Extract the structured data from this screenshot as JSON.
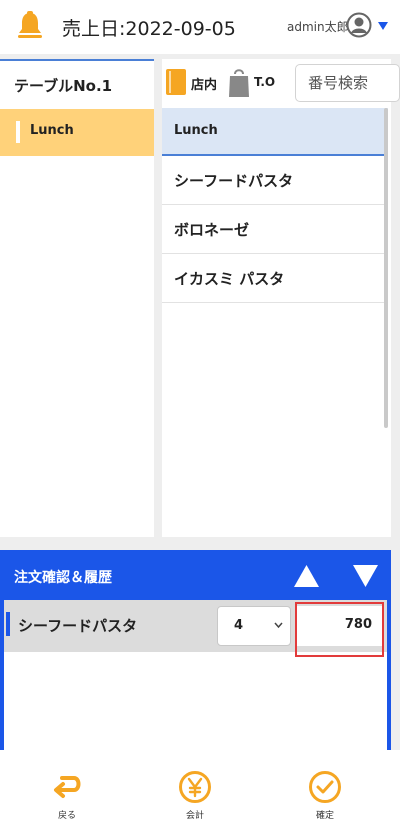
{
  "header": {
    "sales_date": "売上日:2022-09-05",
    "user_name": "admin太郎",
    "icons": [
      "bell-icon",
      "avatar-icon",
      "chevron-down-icon"
    ]
  },
  "left_panel": {
    "table_label": "テーブルNo.1",
    "categories": [
      {
        "label": "Lunch",
        "selected": true
      }
    ]
  },
  "toolbar": {
    "store_label": "店内",
    "takeout_label": "T.O",
    "search_placeholder": "番号検索"
  },
  "menu": {
    "category_header": "Lunch",
    "items": [
      "シーフードパスタ",
      "ボロネーゼ",
      "イカスミ パスタ"
    ]
  },
  "order": {
    "title": "注文確認＆履歴",
    "rows": [
      {
        "name": "シーフードパスタ",
        "quantity": "4",
        "price": "780"
      }
    ]
  },
  "footer": {
    "back_label": "戻る",
    "checkout_label": "会計",
    "confirm_label": "確定"
  },
  "colors": {
    "accent_orange": "#f5a623",
    "primary_blue": "#1b56e8",
    "highlight_red": "#e23b3b",
    "selected_category": "#ffd27a"
  }
}
